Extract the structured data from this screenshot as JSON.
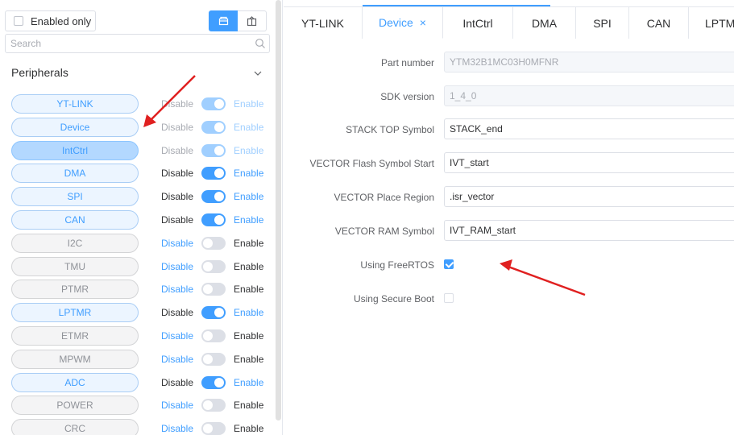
{
  "filter": {
    "enabled_only_label": "Enabled only",
    "search_placeholder": "Search"
  },
  "section": {
    "title": "Peripherals"
  },
  "labels": {
    "disable": "Disable",
    "enable": "Enable"
  },
  "peripherals": [
    {
      "name": "YT-LINK",
      "enabled": true,
      "locked": true
    },
    {
      "name": "Device",
      "enabled": true,
      "locked": true
    },
    {
      "name": "IntCtrl",
      "enabled": true,
      "locked": true,
      "selected": true
    },
    {
      "name": "DMA",
      "enabled": true,
      "locked": false
    },
    {
      "name": "SPI",
      "enabled": true,
      "locked": false
    },
    {
      "name": "CAN",
      "enabled": true,
      "locked": false
    },
    {
      "name": "I2C",
      "enabled": false,
      "locked": false
    },
    {
      "name": "TMU",
      "enabled": false,
      "locked": false
    },
    {
      "name": "PTMR",
      "enabled": false,
      "locked": false
    },
    {
      "name": "LPTMR",
      "enabled": true,
      "locked": false
    },
    {
      "name": "ETMR",
      "enabled": false,
      "locked": false
    },
    {
      "name": "MPWM",
      "enabled": false,
      "locked": false
    },
    {
      "name": "ADC",
      "enabled": true,
      "locked": false
    },
    {
      "name": "POWER",
      "enabled": false,
      "locked": false
    },
    {
      "name": "CRC",
      "enabled": false,
      "locked": false
    }
  ],
  "tabs": [
    {
      "label": "YT-LINK"
    },
    {
      "label": "Device",
      "active": true,
      "close": "×"
    },
    {
      "label": "IntCtrl"
    },
    {
      "label": "DMA"
    },
    {
      "label": "SPI"
    },
    {
      "label": "CAN"
    },
    {
      "label": "LPTM"
    }
  ],
  "form": {
    "part_number": {
      "label": "Part number",
      "value": "YTM32B1MC03H0MFNR"
    },
    "sdk_version": {
      "label": "SDK version",
      "value": "1_4_0"
    },
    "stack_top": {
      "label": "STACK TOP Symbol",
      "value": "STACK_end"
    },
    "vector_flash": {
      "label": "VECTOR Flash Symbol Start",
      "value": "IVT_start"
    },
    "vector_place": {
      "label": "VECTOR Place Region",
      "value": ".isr_vector"
    },
    "vector_ram": {
      "label": "VECTOR RAM Symbol",
      "value": "IVT_RAM_start"
    },
    "using_freertos": {
      "label": "Using FreeRTOS",
      "checked": true
    },
    "using_secure_boot": {
      "label": "Using Secure Boot",
      "checked": false
    }
  },
  "colors": {
    "accent": "#409eff",
    "annotation": "#e02020"
  }
}
